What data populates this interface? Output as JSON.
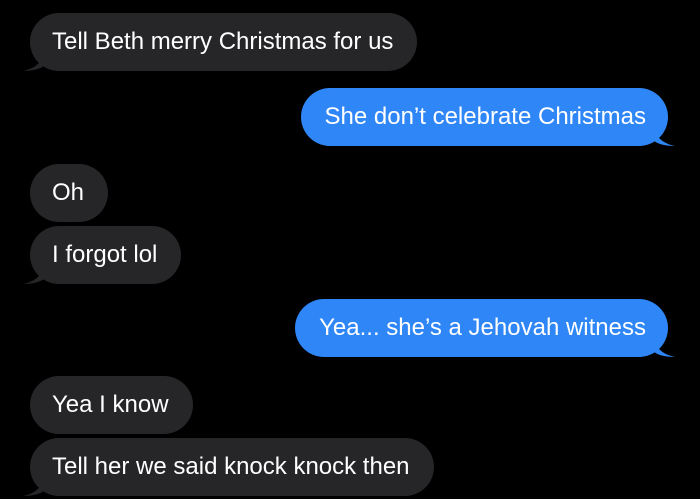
{
  "colors": {
    "background": "#000000",
    "received_bubble": "#262629",
    "sent_bubble": "#2f86f6",
    "text": "#ffffff"
  },
  "messages": [
    {
      "direction": "received",
      "text": "Tell Beth merry Christmas for us",
      "tail": true
    },
    {
      "direction": "sent",
      "text": "She don’t celebrate Christmas",
      "tail": true
    },
    {
      "direction": "received",
      "text": "Oh",
      "tail": false
    },
    {
      "direction": "received",
      "text": "I forgot lol",
      "tail": true
    },
    {
      "direction": "sent",
      "text": "Yea... she’s a Jehovah witness",
      "tail": true
    },
    {
      "direction": "received",
      "text": "Yea I know",
      "tail": false
    },
    {
      "direction": "received",
      "text": "Tell her we said knock knock then",
      "tail": true
    }
  ]
}
